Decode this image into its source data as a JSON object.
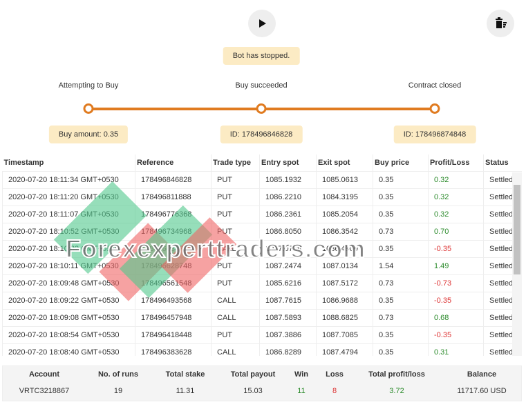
{
  "header": {
    "play_icon": "play-icon",
    "clear_icon": "trash-list-icon",
    "status": "Bot has stopped."
  },
  "steps": [
    {
      "label": "Attempting to Buy",
      "info": "Buy amount: 0.35"
    },
    {
      "label": "Buy succeeded",
      "info": "ID: 178496846828"
    },
    {
      "label": "Contract closed",
      "info": "ID: 178496874848"
    }
  ],
  "table": {
    "columns": [
      "Timestamp",
      "Reference",
      "Trade type",
      "Entry spot",
      "Exit spot",
      "Buy price",
      "Profit/Loss",
      "Status"
    ],
    "rows": [
      [
        "2020-07-20 18:11:34 GMT+0530",
        "178496846828",
        "PUT",
        "1085.1932",
        "1085.0613",
        "0.35",
        "0.32",
        "Settled"
      ],
      [
        "2020-07-20 18:11:20 GMT+0530",
        "178496811888",
        "PUT",
        "1086.2210",
        "1084.3195",
        "0.35",
        "0.32",
        "Settled"
      ],
      [
        "2020-07-20 18:11:07 GMT+0530",
        "178496776368",
        "PUT",
        "1086.2361",
        "1085.2054",
        "0.35",
        "0.32",
        "Settled"
      ],
      [
        "2020-07-20 18:10:52 GMT+0530",
        "178496734968",
        "PUT",
        "1086.8050",
        "1086.3542",
        "0.73",
        "0.70",
        "Settled"
      ],
      [
        "2020-07-20 18:10:32 GMT+0530",
        "178496684728",
        "CALL",
        "1087.0758",
        "1086.4909",
        "0.35",
        "-0.35",
        "Settled"
      ],
      [
        "2020-07-20 18:10:11 GMT+0530",
        "178496628748",
        "PUT",
        "1087.2474",
        "1087.0134",
        "1.54",
        "1.49",
        "Settled"
      ],
      [
        "2020-07-20 18:09:48 GMT+0530",
        "178496561548",
        "PUT",
        "1085.6216",
        "1087.5172",
        "0.73",
        "-0.73",
        "Settled"
      ],
      [
        "2020-07-20 18:09:22 GMT+0530",
        "178496493568",
        "CALL",
        "1087.7615",
        "1086.9688",
        "0.35",
        "-0.35",
        "Settled"
      ],
      [
        "2020-07-20 18:09:08 GMT+0530",
        "178496457948",
        "CALL",
        "1087.5893",
        "1088.6825",
        "0.73",
        "0.68",
        "Settled"
      ],
      [
        "2020-07-20 18:08:54 GMT+0530",
        "178496418448",
        "PUT",
        "1087.3886",
        "1087.7085",
        "0.35",
        "-0.35",
        "Settled"
      ],
      [
        "2020-07-20 18:08:40 GMT+0530",
        "178496383628",
        "CALL",
        "1086.8289",
        "1087.4794",
        "0.35",
        "0.31",
        "Settled"
      ]
    ]
  },
  "summary": {
    "headers": [
      "Account",
      "No. of runs",
      "Total stake",
      "Total payout",
      "Win",
      "Loss",
      "Total profit/loss",
      "Balance"
    ],
    "values": [
      "VRTC3218867",
      "19",
      "11.31",
      "15.03",
      "11",
      "8",
      "3.72",
      "11717.60 USD"
    ]
  },
  "watermark": "Forexexperttraders.com",
  "colors": {
    "accent": "#e07b20",
    "pill": "#fcebc4",
    "profit": "#2a8a2a",
    "loss": "#dd3333"
  }
}
